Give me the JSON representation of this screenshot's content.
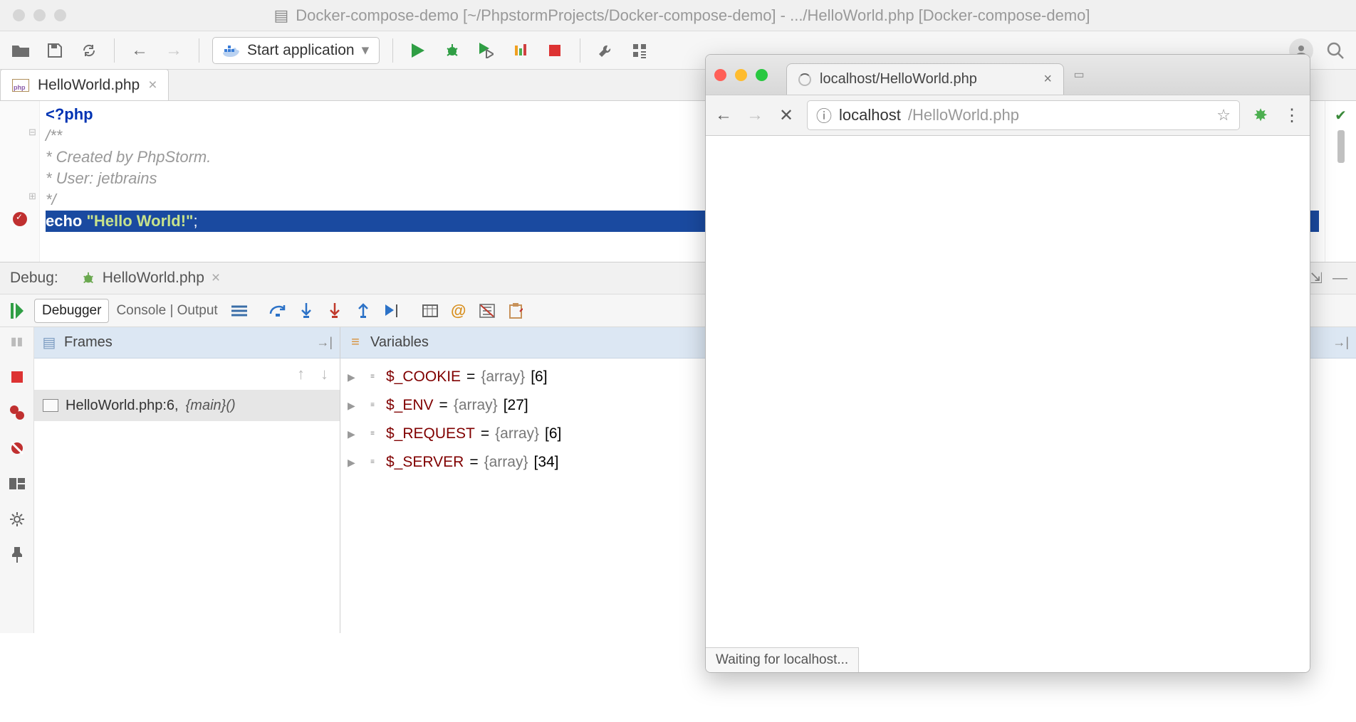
{
  "window": {
    "title": "Docker-compose-demo [~/PhpstormProjects/Docker-compose-demo] - .../HelloWorld.php [Docker-compose-demo]"
  },
  "toolbar": {
    "run_config": "Start application"
  },
  "editor_tab": {
    "filename": "HelloWorld.php",
    "badge": "php"
  },
  "code": {
    "l1": "<?php",
    "l2": "/**",
    "l3": " * Created by PhpStorm.",
    "l4": " * User: jetbrains",
    "l5": " */",
    "l6_a": "echo ",
    "l6_b": "\"Hello World!\"",
    "l6_c": ";"
  },
  "debug": {
    "title": "Debug:",
    "tab": "HelloWorld.php",
    "tabs": {
      "debugger": "Debugger",
      "console": "Console | Output"
    },
    "frames": {
      "title": "Frames",
      "entry_file": "HelloWorld.php:6,",
      "entry_fn": "{main}()"
    },
    "vars": {
      "title": "Variables",
      "items": [
        {
          "name": "$_COOKIE",
          "type": "{array}",
          "count": "[6]"
        },
        {
          "name": "$_ENV",
          "type": "{array}",
          "count": "[27]"
        },
        {
          "name": "$_REQUEST",
          "type": "{array}",
          "count": "[6]"
        },
        {
          "name": "$_SERVER",
          "type": "{array}",
          "count": "[34]"
        }
      ]
    }
  },
  "browser": {
    "tab_title": "localhost/HelloWorld.php",
    "url_host": "localhost",
    "url_path": "/HelloWorld.php",
    "status": "Waiting for localhost..."
  }
}
